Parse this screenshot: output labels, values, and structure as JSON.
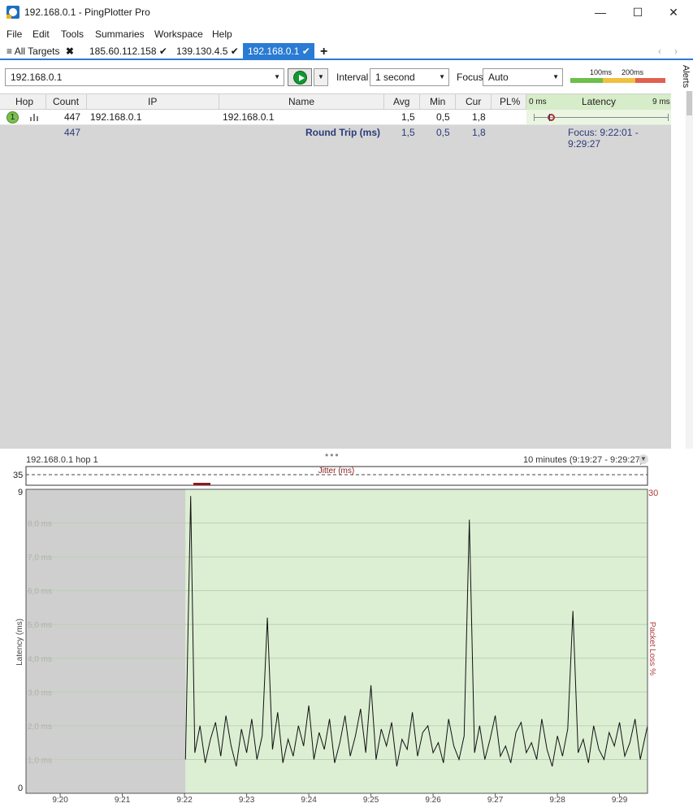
{
  "window": {
    "title": "192.168.0.1 - PingPlotter Pro",
    "minimize": "—",
    "maximize": "☐",
    "close": "✕"
  },
  "menu": [
    "File",
    "Edit",
    "Tools",
    "Summaries",
    "Workspace",
    "Help"
  ],
  "tabs": {
    "all_targets": "All Targets",
    "items": [
      {
        "label": "185.60.112.158",
        "mark": "✔"
      },
      {
        "label": "139.130.4.5",
        "mark": "✔"
      },
      {
        "label": "192.168.0.1",
        "mark": "✔"
      }
    ],
    "add": "+",
    "nav_prev": "‹",
    "nav_next": "›"
  },
  "toolbar": {
    "target": "192.168.0.1",
    "interval_label": "Interval",
    "interval_value": "1 second",
    "focus_label": "Focus",
    "focus_value": "Auto",
    "scale_100": "100ms",
    "scale_200": "200ms",
    "alerts_label": "Alerts",
    "colors": {
      "good": "#6dbf4b",
      "warn": "#f0c040",
      "bad": "#e06050"
    }
  },
  "grid": {
    "headers": {
      "hop": "Hop",
      "count": "Count",
      "ip": "IP",
      "name": "Name",
      "avg": "Avg",
      "min": "Min",
      "cur": "Cur",
      "pl": "PL%",
      "lat_min": "0 ms",
      "latency": "Latency",
      "lat_max": "9 ms"
    },
    "rows": [
      {
        "hop": "1",
        "count": "447",
        "ip": "192.168.0.1",
        "name": "192.168.0.1",
        "avg": "1,5",
        "min": "0,5",
        "cur": "1,8",
        "pl": ""
      }
    ],
    "summary": {
      "count": "447",
      "label": "Round Trip (ms)",
      "avg": "1,5",
      "min": "0,5",
      "cur": "1,8",
      "focus": "Focus: 9:22:01 - 9:29:27"
    }
  },
  "graph": {
    "title": "192.168.0.1 hop 1",
    "range": "10 minutes (9:19:27 - 9:29:27)",
    "jitter_label": "Jitter (ms)",
    "jitter_max": "35",
    "y_left_max": "9",
    "y_left_min": "0",
    "y_right_max": "30",
    "ylabel_left": "Latency (ms)",
    "ylabel_right": "Packet Loss %",
    "gridlines": [
      "8,0 ms",
      "7,0 ms",
      "6,0 ms",
      "5,0 ms",
      "4,0 ms",
      "3,0 ms",
      "2,0 ms",
      "1,0 ms"
    ],
    "x_ticks": [
      "9:20",
      "9:21",
      "9:22",
      "9:23",
      "9:24",
      "9:25",
      "9:26",
      "9:27",
      "9:28",
      "9:29"
    ],
    "colors": {
      "focus_bg": "#dcefd3",
      "nodata_bg": "#cfcfcf",
      "line": "#111111",
      "jitter_mark": "#8b1a1a",
      "right_axis": "#b03a3a"
    }
  },
  "chart_data": {
    "type": "line",
    "title": "192.168.0.1 hop 1",
    "xlabel": "",
    "ylabel": "Latency (ms)",
    "ylim": [
      0,
      9
    ],
    "x_range": [
      "9:19:27",
      "9:29:27"
    ],
    "data_start": "9:22:01",
    "series": [
      {
        "name": "Latency (ms)",
        "x": [
          "9:22:01",
          "9:22:06",
          "9:22:10",
          "9:22:15",
          "9:22:20",
          "9:22:25",
          "9:22:30",
          "9:22:35",
          "9:22:40",
          "9:22:45",
          "9:22:50",
          "9:22:55",
          "9:23:00",
          "9:23:05",
          "9:23:10",
          "9:23:15",
          "9:23:20",
          "9:23:25",
          "9:23:30",
          "9:23:35",
          "9:23:40",
          "9:23:45",
          "9:23:50",
          "9:23:55",
          "9:24:00",
          "9:24:05",
          "9:24:10",
          "9:24:15",
          "9:24:20",
          "9:24:25",
          "9:24:30",
          "9:24:35",
          "9:24:40",
          "9:24:45",
          "9:24:50",
          "9:24:55",
          "9:25:00",
          "9:25:05",
          "9:25:10",
          "9:25:15",
          "9:25:20",
          "9:25:25",
          "9:25:30",
          "9:25:35",
          "9:25:40",
          "9:25:45",
          "9:25:50",
          "9:25:55",
          "9:26:00",
          "9:26:05",
          "9:26:10",
          "9:26:15",
          "9:26:20",
          "9:26:25",
          "9:26:30",
          "9:26:35",
          "9:26:40",
          "9:26:45",
          "9:26:50",
          "9:26:55",
          "9:27:00",
          "9:27:05",
          "9:27:10",
          "9:27:15",
          "9:27:20",
          "9:27:25",
          "9:27:30",
          "9:27:35",
          "9:27:40",
          "9:27:45",
          "9:27:50",
          "9:27:55",
          "9:28:00",
          "9:28:05",
          "9:28:10",
          "9:28:15",
          "9:28:20",
          "9:28:25",
          "9:28:30",
          "9:28:35",
          "9:28:40",
          "9:28:45",
          "9:28:50",
          "9:28:55",
          "9:29:00",
          "9:29:05",
          "9:29:10",
          "9:29:15",
          "9:29:20",
          "9:29:27"
        ],
        "y": [
          1.0,
          8.8,
          1.2,
          2.0,
          0.9,
          1.6,
          2.1,
          1.1,
          2.3,
          1.4,
          0.8,
          1.9,
          1.2,
          2.2,
          1.0,
          1.7,
          5.2,
          1.3,
          2.4,
          0.9,
          1.6,
          1.1,
          2.0,
          1.4,
          2.6,
          1.0,
          1.8,
          1.3,
          2.2,
          0.9,
          1.5,
          2.3,
          1.1,
          1.7,
          2.5,
          1.2,
          3.2,
          1.0,
          1.9,
          1.4,
          2.1,
          0.8,
          1.6,
          1.3,
          2.4,
          1.1,
          1.8,
          2.0,
          1.2,
          1.5,
          0.9,
          2.2,
          1.4,
          1.0,
          1.7,
          8.1,
          1.2,
          2.0,
          1.0,
          1.6,
          2.3,
          1.1,
          1.4,
          0.9,
          1.8,
          2.1,
          1.2,
          1.5,
          1.0,
          2.2,
          1.3,
          0.8,
          1.7,
          1.1,
          1.9,
          5.4,
          1.2,
          1.6,
          0.9,
          2.0,
          1.3,
          1.0,
          1.8,
          1.4,
          2.1,
          1.1,
          1.5,
          2.2,
          1.0,
          2.0
        ]
      }
    ],
    "grid": true
  }
}
